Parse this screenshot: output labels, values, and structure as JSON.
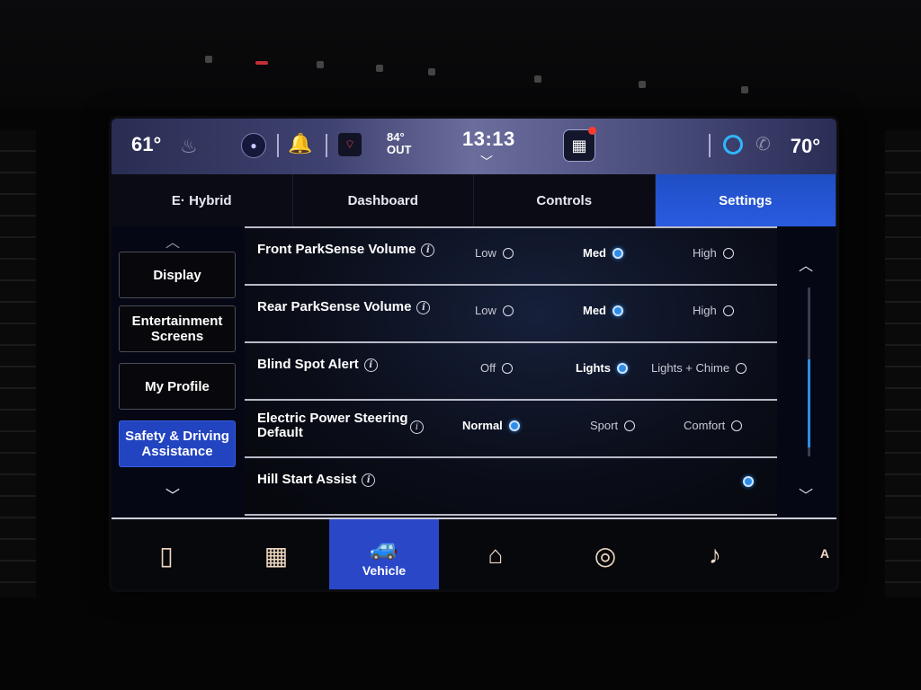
{
  "status_bar": {
    "driver_temp": "61°",
    "outside_temp_value": "84°",
    "outside_temp_label": "OUT",
    "clock": "13:13",
    "passenger_temp": "70°"
  },
  "top_tabs": [
    {
      "label": "E· Hybrid",
      "active": false
    },
    {
      "label": "Dashboard",
      "active": false
    },
    {
      "label": "Controls",
      "active": false
    },
    {
      "label": "Settings",
      "active": true
    }
  ],
  "left_nav": {
    "items": [
      {
        "label": "Display",
        "active": false
      },
      {
        "label": "Entertainment Screens",
        "active": false
      },
      {
        "label": "My Profile",
        "active": false
      },
      {
        "label": "Safety & Driving Assistance",
        "active": true
      }
    ]
  },
  "settings": [
    {
      "label": "Front ParkSense Volume",
      "options": [
        {
          "label": "Low",
          "selected": false
        },
        {
          "label": "Med",
          "selected": true
        },
        {
          "label": "High",
          "selected": false
        }
      ]
    },
    {
      "label": "Rear ParkSense Volume",
      "options": [
        {
          "label": "Low",
          "selected": false
        },
        {
          "label": "Med",
          "selected": true
        },
        {
          "label": "High",
          "selected": false
        }
      ]
    },
    {
      "label": "Blind Spot Alert",
      "options": [
        {
          "label": "Off",
          "selected": false
        },
        {
          "label": "Lights",
          "selected": true
        },
        {
          "label": "Lights + Chime",
          "selected": false
        }
      ]
    },
    {
      "label": "Electric Power Steering Default",
      "options": [
        {
          "label": "Normal",
          "selected": true
        },
        {
          "label": "Sport",
          "selected": false
        },
        {
          "label": "Comfort",
          "selected": false
        }
      ]
    },
    {
      "label": "Hill Start Assist",
      "options": [
        {
          "label": "",
          "selected": true
        }
      ]
    }
  ],
  "dock": {
    "items": [
      {
        "icon": "phone-icon",
        "label": "",
        "active": false
      },
      {
        "icon": "apps-grid-icon",
        "label": "",
        "active": false
      },
      {
        "icon": "vehicle-icon",
        "label": "Vehicle",
        "active": true
      },
      {
        "icon": "home-icon",
        "label": "",
        "active": false
      },
      {
        "icon": "compass-icon",
        "label": "",
        "active": false
      },
      {
        "icon": "music-note-icon",
        "label": "",
        "active": false
      }
    ],
    "corner_glyph": "A"
  },
  "colors": {
    "accent": "#2a47c8",
    "radio_selected": "#2f8de8",
    "notification_dot": "#ff3b30",
    "alexa_ring": "#2fb6ff"
  }
}
